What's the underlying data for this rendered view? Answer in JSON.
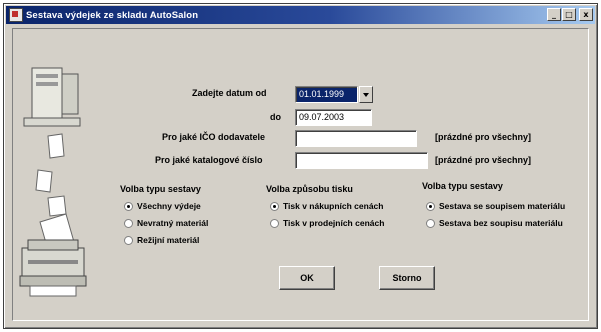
{
  "window": {
    "title": "Sestava výdejek ze skladu AutoSalon",
    "min_label": "_",
    "max_label": "□",
    "close_label": "x"
  },
  "form": {
    "date_from_label": "Zadejte datum od",
    "date_from_value": "01.01.1999",
    "date_to_label": "do",
    "date_to_value": "09.07.2003",
    "ico_label": "Pro jaké IČO dodavatele",
    "ico_value": "",
    "ico_hint": "[prázdné pro všechny]",
    "catalog_label": "Pro jaké katalogové číslo",
    "catalog_value": "",
    "catalog_hint": "[prázdné pro všechny]"
  },
  "groups": {
    "report_type": {
      "title": "Volba typu sestavy",
      "options": [
        "Všechny výdeje",
        "Nevratný materiál",
        "Režijní materiál"
      ],
      "selected": 0
    },
    "print_mode": {
      "title": "Volba způsobu tisku",
      "options": [
        "Tisk v nákupních cenách",
        "Tisk v prodejních cenách"
      ],
      "selected": 0
    },
    "report_type2": {
      "title": "Volba typu sestavy",
      "options": [
        "Sestava se soupisem materiálu",
        "Sestava bez soupisu materiálu"
      ],
      "selected": 0
    }
  },
  "buttons": {
    "ok": "OK",
    "cancel": "Storno"
  },
  "colors": {
    "window_bg": "#d4d0c8",
    "title_start": "#0a246a",
    "title_end": "#a6caf0",
    "selection": "#0a246a"
  },
  "icons": {
    "app": "app-icon",
    "dropdown": "chevron-down-icon",
    "illustration": "printer-illustration"
  }
}
